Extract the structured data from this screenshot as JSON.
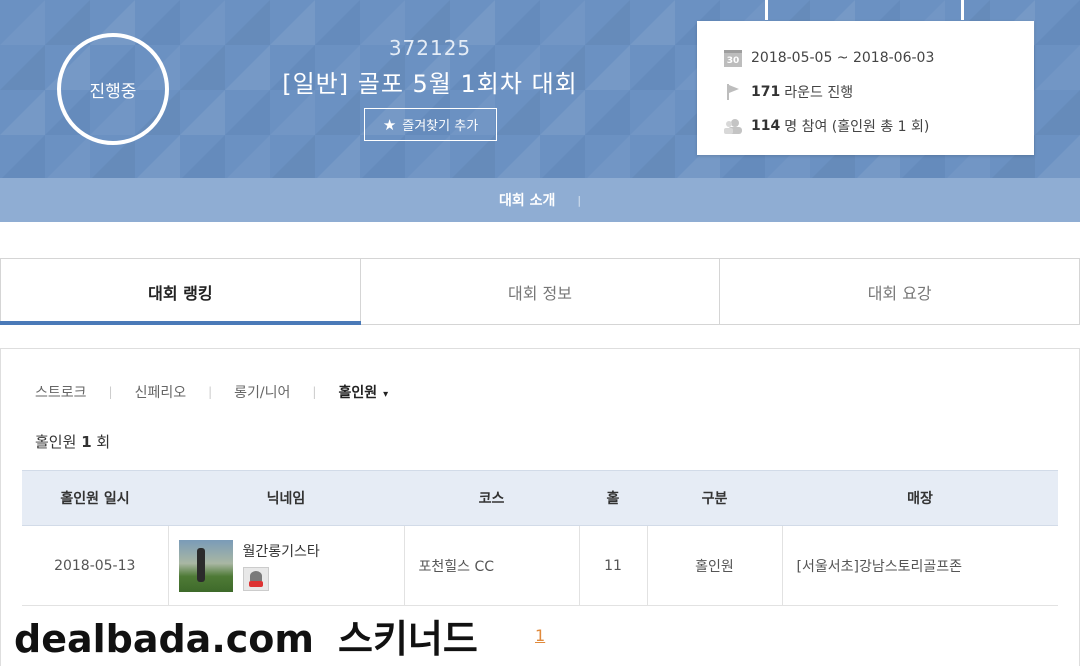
{
  "hero": {
    "status": "진행중",
    "competition_id": "372125",
    "title": "[일반] 골포 5월 1회차 대회",
    "favorite_label": "즐겨찾기 추가",
    "info": {
      "calendar_icon_text": "30",
      "date_range": "2018-05-05 ~ 2018-06-03",
      "rounds_count": "171",
      "rounds_label": "라운드 진행",
      "participants_count": "114",
      "participants_label": "명 참여 (홀인원 총 1 회)"
    },
    "subnav_label": "대회 소개",
    "subnav_sep": "|"
  },
  "tabs": [
    {
      "label": "대회 랭킹",
      "active": true
    },
    {
      "label": "대회 정보",
      "active": false
    },
    {
      "label": "대회 요강",
      "active": false
    }
  ],
  "filters": {
    "items": [
      "스트로크",
      "신페리오",
      "롱기/니어",
      "홀인원"
    ],
    "separator": "|",
    "active_caret": "▾"
  },
  "holeinone_summary": {
    "label": "홀인원",
    "count": "1",
    "unit": "회"
  },
  "table": {
    "headers": [
      "홀인원 일시",
      "닉네임",
      "코스",
      "홀",
      "구분",
      "매장"
    ],
    "rows": [
      {
        "date": "2018-05-13",
        "nickname": "월간롱기스타",
        "course": "포천힐스 CC",
        "hole": "11",
        "type": "홀인원",
        "store": "[서울서초]강남스토리골프존"
      }
    ]
  },
  "pagination": {
    "current": "1"
  },
  "watermark": {
    "site": "dealbada.com",
    "user": "스키너드"
  },
  "colors": {
    "hero_bg": "#6b91c2",
    "subnav_bg": "#8fadd3",
    "accent": "#4a7ab8",
    "table_header_bg": "#e6ecf5",
    "page_link": "#e08a3c"
  },
  "icons": {
    "favorite": "star-icon",
    "calendar": "calendar-icon",
    "rounds": "flag-icon",
    "participants": "people-icon",
    "dropdown": "caret-down-icon"
  }
}
